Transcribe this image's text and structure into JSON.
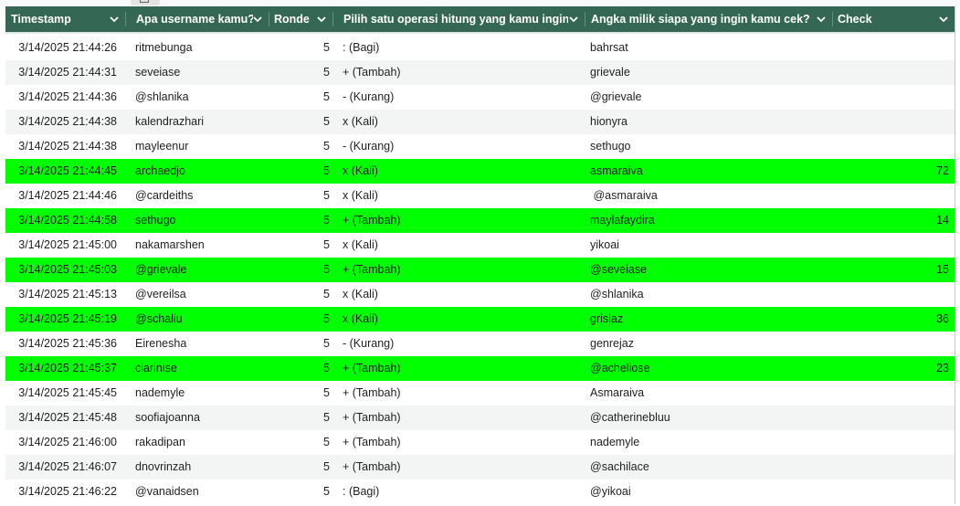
{
  "header": {
    "columns": [
      {
        "label": "Timestamp",
        "icon": "chevron-down-icon"
      },
      {
        "label": "Apa username kamu?",
        "icon": "chevron-down-icon"
      },
      {
        "label": "Ronde",
        "icon": "chevron-down-icon"
      },
      {
        "label": "Pilih satu operasi hitung yang kamu inginkan.",
        "icon": "chevron-down-icon"
      },
      {
        "label": "Angka milik siapa yang ingin kamu cek? Sebutkan username-nya.",
        "icon": "chevron-down-icon"
      },
      {
        "label": "Check",
        "icon": "chevron-down-icon"
      }
    ]
  },
  "colors": {
    "header_bg": "#356854",
    "highlight": "#00ff00",
    "alt_row": "#f3f5f4"
  },
  "rows": [
    {
      "timestamp": "3/14/2025 21:44:26",
      "username": "ritmebunga",
      "ronde": "5",
      "operasi": ": (Bagi)",
      "target": "bahrsat",
      "check": "",
      "highlight": false
    },
    {
      "timestamp": "3/14/2025 21:44:31",
      "username": "seveiase",
      "ronde": "5",
      "operasi": "+ (Tambah)",
      "target": "grievale",
      "check": "",
      "highlight": false
    },
    {
      "timestamp": "3/14/2025 21:44:36",
      "username": "@shlanika",
      "ronde": "5",
      "operasi": "- (Kurang)",
      "target": "@grievale",
      "check": "",
      "highlight": false
    },
    {
      "timestamp": "3/14/2025 21:44:38",
      "username": "kalendrazhari",
      "ronde": "5",
      "operasi": "x (Kali)",
      "target": "hionyra",
      "check": "",
      "highlight": false
    },
    {
      "timestamp": "3/14/2025 21:44:38",
      "username": "mayleenur",
      "ronde": "5",
      "operasi": "- (Kurang)",
      "target": "sethugo",
      "check": "",
      "highlight": false
    },
    {
      "timestamp": "3/14/2025 21:44:45",
      "username": "archaedjo",
      "ronde": "5",
      "operasi": "x (Kali)",
      "target": "asmaraiva",
      "check": "72",
      "highlight": true
    },
    {
      "timestamp": "3/14/2025 21:44:46",
      "username": "@cardeiths",
      "ronde": "5",
      "operasi": "x (Kali)",
      "target": " @asmaraiva",
      "check": "",
      "highlight": false
    },
    {
      "timestamp": "3/14/2025 21:44:58",
      "username": "sethugo",
      "ronde": "5",
      "operasi": "+ (Tambah)",
      "target": "maylafaydira",
      "check": "14",
      "highlight": true
    },
    {
      "timestamp": "3/14/2025 21:45:00",
      "username": "nakamarshen",
      "ronde": "5",
      "operasi": "x (Kali)",
      "target": "yikoai",
      "check": "",
      "highlight": false
    },
    {
      "timestamp": "3/14/2025 21:45:03",
      "username": "@grievale",
      "ronde": "5",
      "operasi": "+ (Tambah)",
      "target": "@seveiase",
      "check": "15",
      "highlight": true
    },
    {
      "timestamp": "3/14/2025 21:45:13",
      "username": "@vereilsa",
      "ronde": "5",
      "operasi": "x (Kali)",
      "target": "@shlanika",
      "check": "",
      "highlight": false
    },
    {
      "timestamp": "3/14/2025 21:45:19",
      "username": "@schaliu",
      "ronde": "5",
      "operasi": "x (Kali)",
      "target": "grislaz",
      "check": "36",
      "highlight": true
    },
    {
      "timestamp": "3/14/2025 21:45:36",
      "username": "Eirenesha",
      "ronde": "5",
      "operasi": "- (Kurang)",
      "target": "genrejaz",
      "check": "",
      "highlight": false
    },
    {
      "timestamp": "3/14/2025 21:45:37",
      "username": "ciarinise",
      "ronde": "5",
      "operasi": "+ (Tambah)",
      "target": "@acheliose",
      "check": "23",
      "highlight": true
    },
    {
      "timestamp": "3/14/2025 21:45:45",
      "username": "nademyle",
      "ronde": "5",
      "operasi": "+ (Tambah)",
      "target": "Asmaraiva",
      "check": "",
      "highlight": false
    },
    {
      "timestamp": "3/14/2025 21:45:48",
      "username": "soofiajoanna",
      "ronde": "5",
      "operasi": "+ (Tambah)",
      "target": "@catherinebluu",
      "check": "",
      "highlight": false
    },
    {
      "timestamp": "3/14/2025 21:46:00",
      "username": "rakadipan",
      "ronde": "5",
      "operasi": "+ (Tambah)",
      "target": "nademyle",
      "check": "",
      "highlight": false
    },
    {
      "timestamp": "3/14/2025 21:46:07",
      "username": "dnovrinzah",
      "ronde": "5",
      "operasi": "+ (Tambah)",
      "target": "@sachilace",
      "check": "",
      "highlight": false
    },
    {
      "timestamp": "3/14/2025 21:46:22",
      "username": "@vanaidsen",
      "ronde": "5",
      "operasi": ": (Bagi)",
      "target": "@yikoai",
      "check": "",
      "highlight": false
    }
  ]
}
